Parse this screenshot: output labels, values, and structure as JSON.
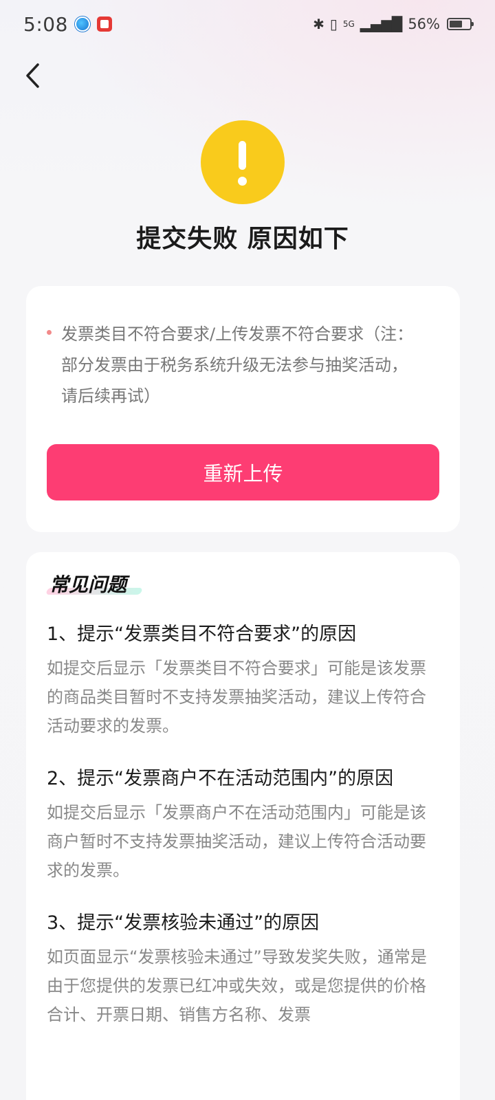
{
  "status_bar": {
    "time": "5:08",
    "battery": "56%",
    "network": "5G"
  },
  "header": {
    "title": "提交失败 原因如下"
  },
  "reason_card": {
    "reason": "发票类目不符合要求/上传发票不符合要求（注：部分发票由于税务系统升级无法参与抽奖活动，请后续再试）",
    "button_label": "重新上传"
  },
  "faq": {
    "heading": "常见问题",
    "items": [
      {
        "question": "1、提示“发票类目不符合要求”的原因",
        "answer": "如提交后显示「发票类目不符合要求」可能是该发票的商品类目暂时不支持发票抽奖活动，建议上传符合活动要求的发票。"
      },
      {
        "question": "2、提示“发票商户不在活动范围内”的原因",
        "answer": "如提交后显示「发票商户不在活动范围内」可能是该商户暂时不支持发票抽奖活动，建议上传符合活动要求的发票。"
      },
      {
        "question": "3、提示“发票核验未通过”的原因",
        "answer": "如页面显示“发票核验未通过”导致发奖失败，通常是由于您提供的发票已红冲或失效，或是您提供的价格合计、开票日期、销售方名称、发票"
      }
    ]
  },
  "colors": {
    "accent": "#fd3d73",
    "warning": "#f9cb1c"
  }
}
